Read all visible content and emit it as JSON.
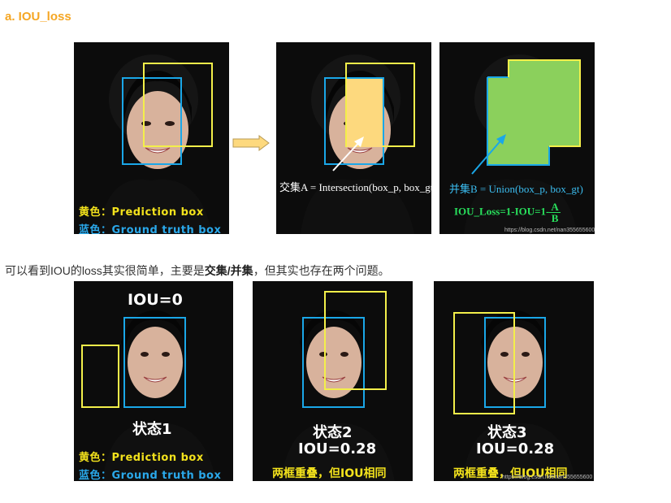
{
  "heading": "a. IOU_loss",
  "paragraph": {
    "before": "可以看到IOU的loss其实很简单，主要是",
    "bold": "交集/并集",
    "after": "，但其实也存在两个问题。"
  },
  "legend": {
    "yellow_label": "黄色：Prediction box",
    "blue_label": "蓝色：Ground truth box"
  },
  "top_row": {
    "intersection_label": "交集A = Intersection(box_p, box_gt)",
    "union_label": "并集B = Union(box_p, box_gt)",
    "formula_prefix": "IOU_Loss=1-IOU=1-",
    "formula_num": "A",
    "formula_den": "B"
  },
  "bottom_row": {
    "iou_zero": "IOU=0",
    "state1": "状态1",
    "state2": "状态2",
    "state3": "状态3",
    "iou_value_2": "IOU=0.28",
    "iou_value_3": "IOU=0.28",
    "caption_2": "两框重叠，但IOU相同",
    "caption_3": "两框重叠，但IOU相同"
  },
  "watermark": "https://blog.csdn.net/nan355655600",
  "colors": {
    "heading": "#f5a623",
    "prediction_box": "#f3ef4a",
    "ground_truth_box": "#1aa7e8",
    "intersection_fill": "#fdd97e",
    "union_fill": "#8bd05c",
    "formula": "#28e05c"
  }
}
